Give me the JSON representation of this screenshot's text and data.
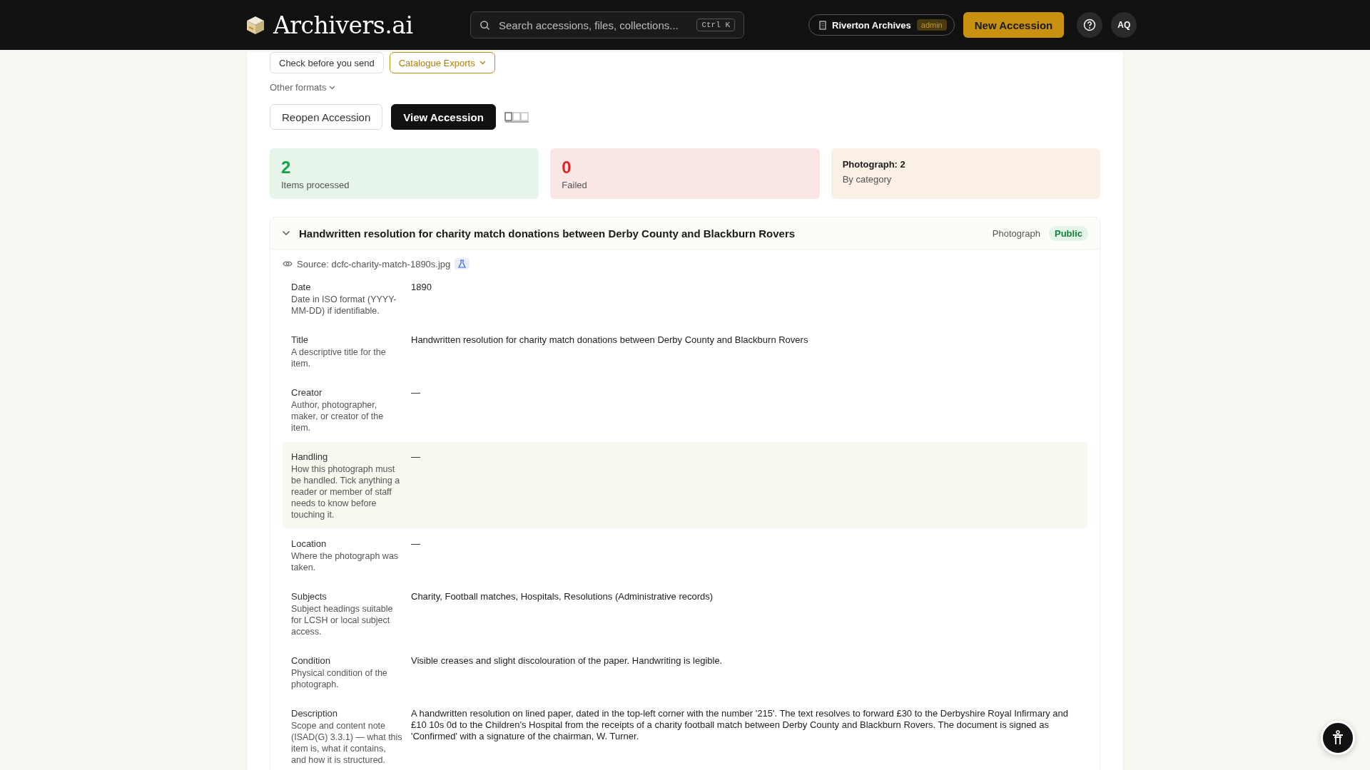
{
  "header": {
    "brand": "Archivers.ai",
    "search": {
      "placeholder": "Search accessions, files, collections...",
      "shortcut": "Ctrl K"
    },
    "org": {
      "name": "Riverton Archives",
      "role": "admin"
    },
    "primary_button": "New Accession",
    "avatar": "AQ"
  },
  "export_buttons": [
    {
      "label": "Check before you send",
      "kind": "plain"
    },
    {
      "label": "Catalogue Exports",
      "kind": "dropdown"
    }
  ],
  "other_formats": "Other formats",
  "actions": [
    {
      "label": "Reopen Accession",
      "kind": "secondary"
    },
    {
      "label": "View Accession",
      "kind": "primary"
    }
  ],
  "stats": [
    {
      "value": "2",
      "label": "Items processed",
      "kind": "success"
    },
    {
      "value": "0",
      "label": "Failed",
      "kind": "error"
    },
    {
      "value": "Photograph: 2",
      "label": "By category",
      "kind": "summary"
    }
  ],
  "item": {
    "title": "Handwritten resolution for charity match donations between Derby County and Blackburn Rovers",
    "expanded": true,
    "category": "Photograph",
    "visibility": "Public",
    "source": "Source: dcfc-charity-match-1890s.jpg",
    "fields": [
      {
        "label": "Date",
        "hint": "Date in ISO format (YYYY-MM-DD) if identifiable.",
        "value": "1890",
        "highlighted": false
      },
      {
        "label": "Title",
        "hint": "A descriptive title for the item.",
        "value": "Handwritten resolution for charity match donations between Derby County and Blackburn Rovers",
        "highlighted": false
      },
      {
        "label": "Creator",
        "hint": "Author, photographer, maker, or creator of the item.",
        "value": "—",
        "highlighted": false
      },
      {
        "label": "Handling",
        "hint": "How this photograph must be handled. Tick anything a reader or member of staff needs to know before touching it.",
        "value": "—",
        "highlighted": true
      },
      {
        "label": "Location",
        "hint": "Where the photograph was taken.",
        "value": "—",
        "highlighted": false
      },
      {
        "label": "Subjects",
        "hint": "Subject headings suitable for LCSH or local subject access.",
        "value": "Charity, Football matches, Hospitals, Resolutions (Administrative records)",
        "highlighted": false
      },
      {
        "label": "Condition",
        "hint": "Physical condition of the photograph.",
        "value": "Visible creases and slight discolouration of the paper. Handwriting is legible.",
        "highlighted": false
      },
      {
        "label": "Description",
        "hint": "Scope and content note (ISAD(G) 3.3.1) — what this item is, what it contains, and how it is structured.",
        "value": "A handwritten resolution on lined paper, dated in the top-left corner with the number '215'. The text resolves to forward £30 to the Derbyshire Royal Infirmary and £10 10s 0d to the Children's Hospital from the receipts of a charity football match between Derby County and Blackburn Rovers. The document is signed as 'Confirmed' with a signature of the chairman, W. Turner.",
        "highlighted": false
      }
    ]
  }
}
